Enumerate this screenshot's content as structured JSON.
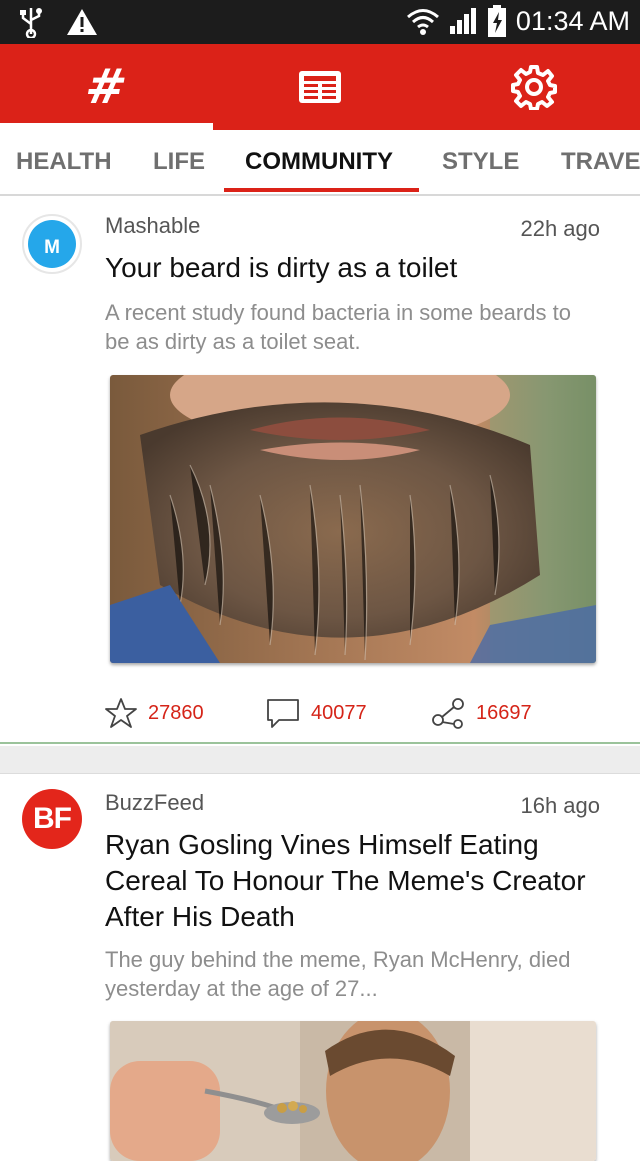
{
  "status_bar": {
    "time": "01:34 AM",
    "icons": [
      "usb-icon",
      "warning-icon",
      "wifi-icon",
      "signal-icon",
      "battery-charging-icon"
    ]
  },
  "app_bar": {
    "color": "#db2218",
    "tabs": [
      {
        "name": "hashtag",
        "label": "#",
        "icon": "hashtag-icon"
      },
      {
        "name": "news",
        "icon": "newspaper-icon"
      },
      {
        "name": "settings",
        "icon": "gear-icon"
      }
    ]
  },
  "categories": {
    "items": [
      "HEALTH",
      "LIFE",
      "COMMUNITY",
      "STYLE",
      "TRAVE"
    ],
    "active": "COMMUNITY",
    "indicator_color": "#db2218"
  },
  "feed": [
    {
      "avatar_text": "M",
      "avatar_color": "#25a7ea",
      "source": "Mashable",
      "time": "22h ago",
      "headline": "Your beard is dirty as a toilet",
      "summary": "A recent study found bacteria in some beards to be as dirty as a toilet seat.",
      "image": "beard-photo",
      "likes": "27860",
      "comments": "40077",
      "shares": "16697"
    },
    {
      "avatar_text": "BF",
      "avatar_color": "#e3261b",
      "source": "BuzzFeed",
      "time": "16h ago",
      "headline": "Ryan Gosling Vines Himself Eating Cereal To Honour The Meme's Creator After His Death",
      "summary": "The guy behind the meme, Ryan McHenry, died yesterday at the age of 27...",
      "image": "cereal-spoon-photo"
    }
  ]
}
